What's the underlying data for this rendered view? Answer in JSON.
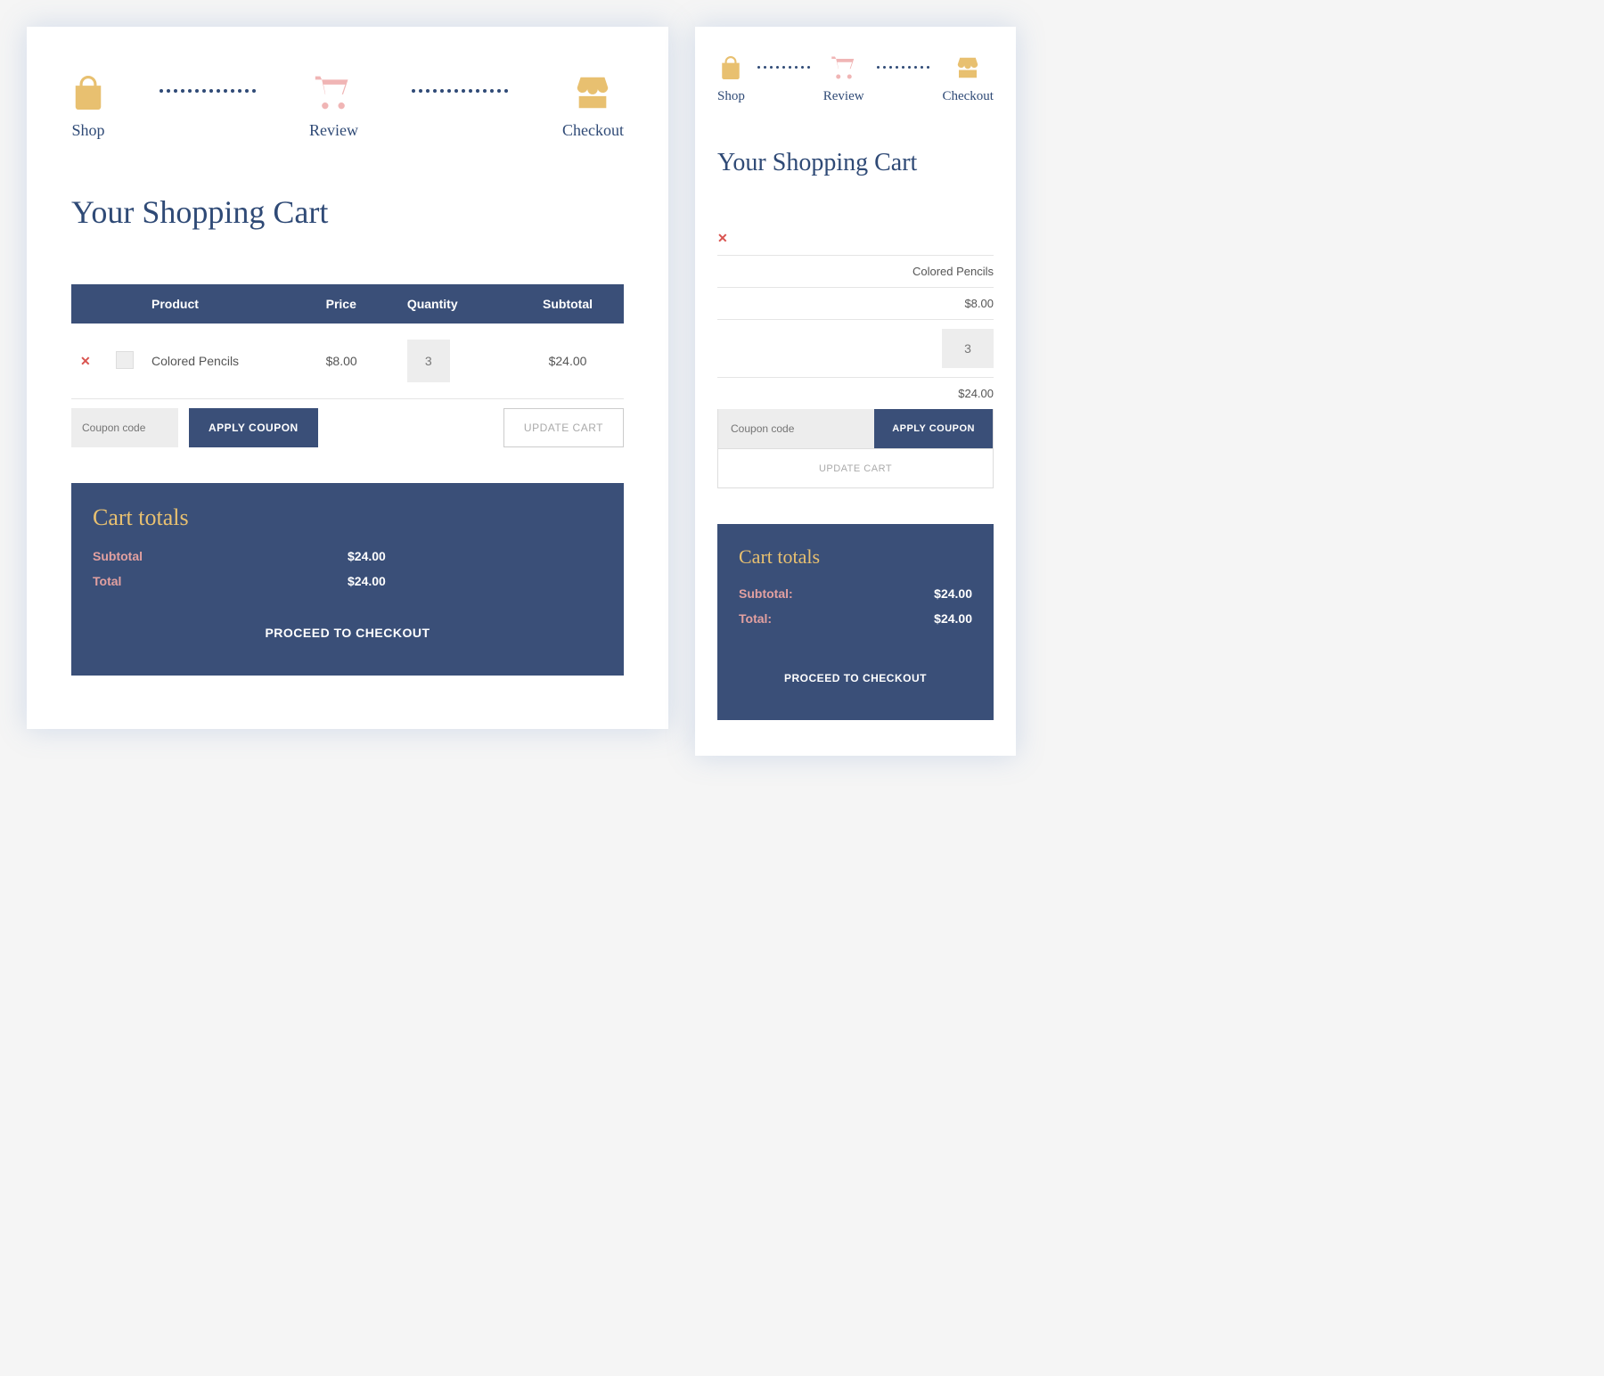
{
  "steps": {
    "shop": "Shop",
    "review": "Review",
    "checkout": "Checkout"
  },
  "title": "Your Shopping Cart",
  "table": {
    "headers": {
      "product": "Product",
      "price": "Price",
      "quantity": "Quantity",
      "subtotal": "Subtotal"
    },
    "row": {
      "name": "Colored Pencils",
      "price": "$8.00",
      "qty": "3",
      "subtotal": "$24.00"
    }
  },
  "coupon": {
    "placeholder": "Coupon code",
    "apply": "APPLY COUPON",
    "update": "UPDATE CART"
  },
  "totals": {
    "heading": "Cart totals",
    "subtotal_label": "Subtotal",
    "subtotal_label_m": "Subtotal:",
    "subtotal_value": "$24.00",
    "total_label": "Total",
    "total_label_m": "Total:",
    "total_value": "$24.00",
    "checkout": "PROCEED TO CHECKOUT"
  }
}
